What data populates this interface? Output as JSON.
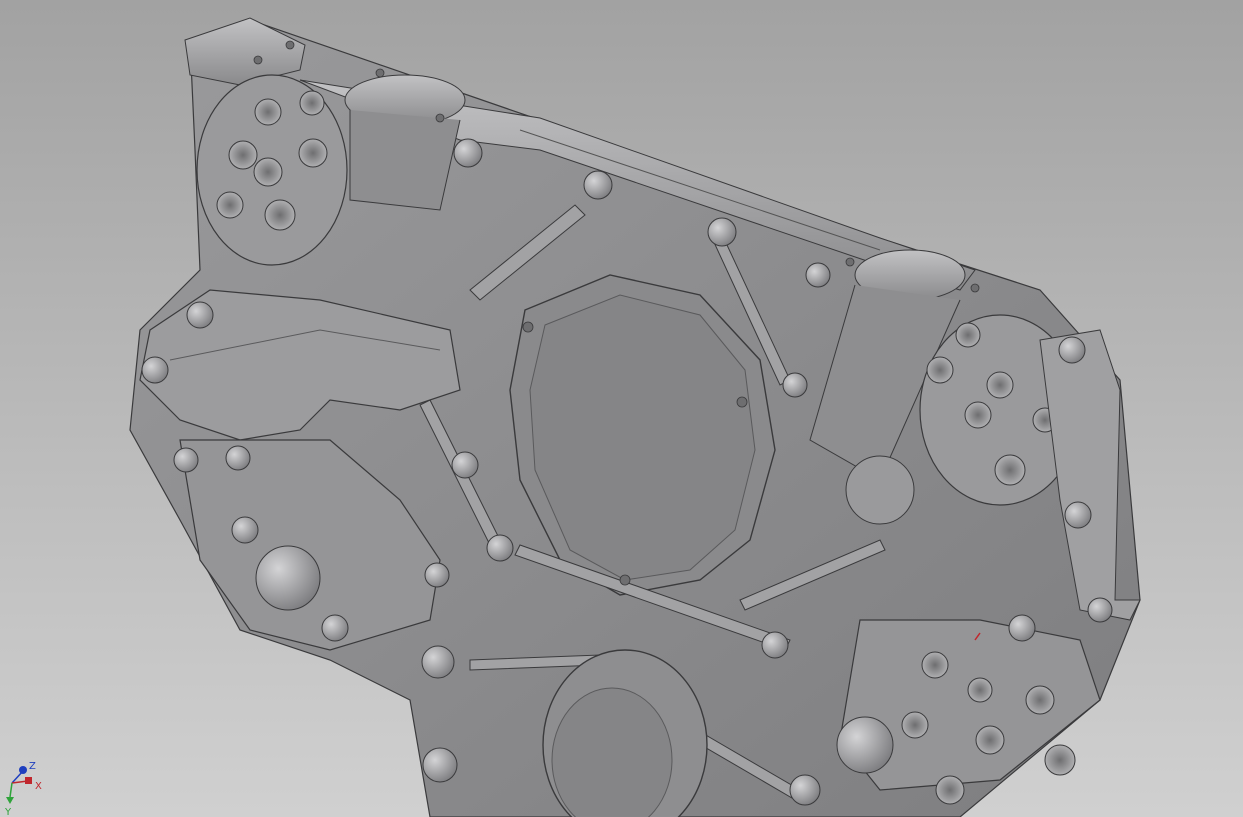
{
  "viewport": {
    "background_top": "#a2a2a2",
    "background_bottom": "#d0d0d0",
    "model_color": "#8c8c8e",
    "model_highlight": "#b4b4b6",
    "edge_color": "#3a3a3c"
  },
  "triad": {
    "x_label": "X",
    "y_label": "Y",
    "z_label": "Z",
    "x_color": "#c0272d",
    "y_color": "#2fa33a",
    "z_color": "#1f3fbf"
  }
}
